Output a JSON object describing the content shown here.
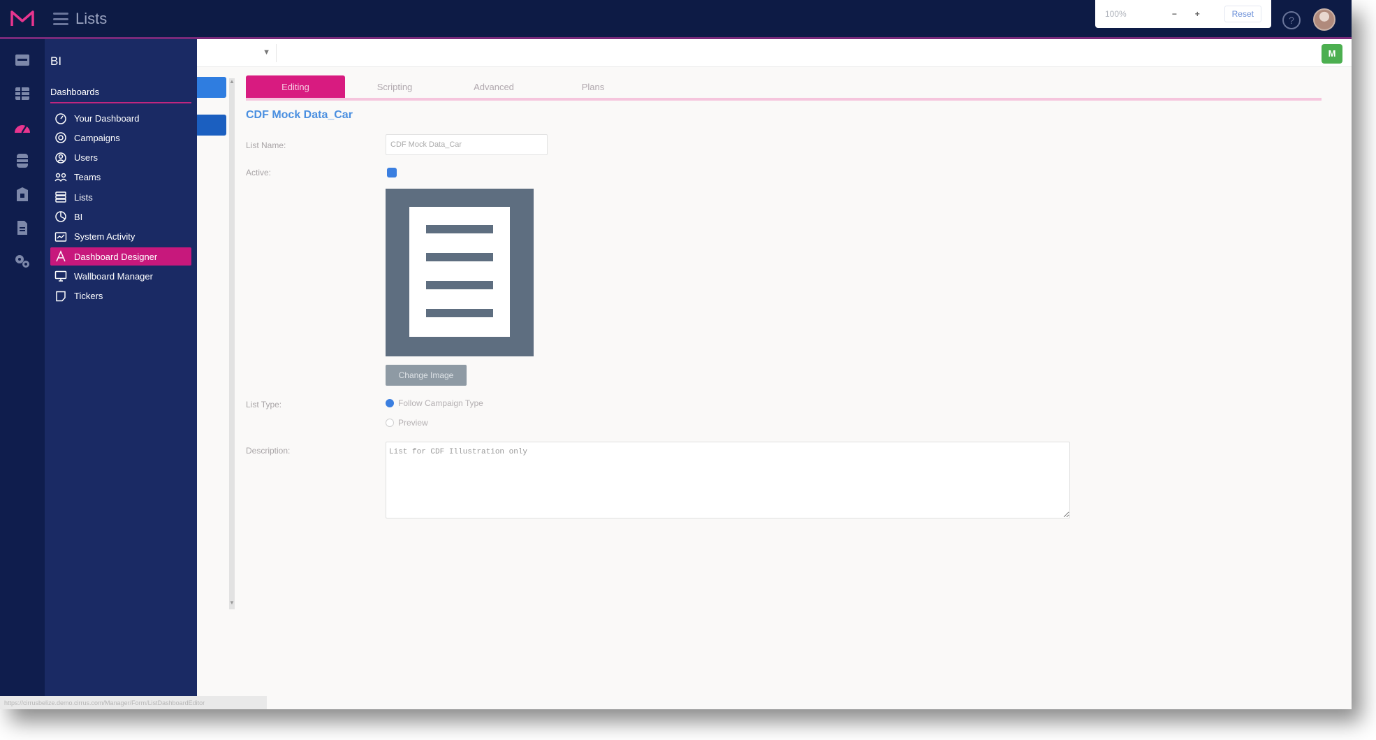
{
  "topbar": {
    "page_title": "Lists",
    "zoom": {
      "value": "100%",
      "minus": "−",
      "plus": "+",
      "reset": "Reset"
    },
    "help": "?"
  },
  "sidebar": {
    "title": "BI",
    "section": "Dashboards",
    "items": [
      {
        "label": "Your Dashboard",
        "icon": "dashboard-gauge-icon"
      },
      {
        "label": "Campaigns",
        "icon": "campaign-icon"
      },
      {
        "label": "Users",
        "icon": "user-circle-icon"
      },
      {
        "label": "Teams",
        "icon": "team-icon"
      },
      {
        "label": "Lists",
        "icon": "list-icon"
      },
      {
        "label": "BI",
        "icon": "chart-pie-icon"
      },
      {
        "label": "System Activity",
        "icon": "activity-icon"
      },
      {
        "label": "Dashboard Designer",
        "icon": "designer-icon",
        "active": true
      },
      {
        "label": "Wallboard Manager",
        "icon": "monitor-icon"
      },
      {
        "label": "Tickers",
        "icon": "ticker-icon"
      }
    ]
  },
  "toolbar": {
    "app_badge": "M"
  },
  "tabs": [
    {
      "label": "Editing",
      "active": true
    },
    {
      "label": "Scripting"
    },
    {
      "label": "Advanced"
    },
    {
      "label": "Plans"
    }
  ],
  "form": {
    "record_title": "CDF Mock Data_Car",
    "list_name_label": "List Name:",
    "list_name_value": "CDF Mock Data_Car",
    "active_label": "Active:",
    "active_checked": true,
    "change_image_label": "Change Image",
    "list_type_label": "List Type:",
    "list_type_options": [
      {
        "label": "Follow Campaign Type",
        "selected": true
      },
      {
        "label": "Preview",
        "selected": false
      }
    ],
    "description_label": "Description:",
    "description_value": "List for CDF Illustration only"
  },
  "status_url": "https://cirrusbelize.demo.cirrus.com/Manager/Form/ListDashboardEditor",
  "colors": {
    "topbar": "#0d1b45",
    "sidebar": "#1a2a64",
    "accent": "#d81b80",
    "link": "#4a8fe0",
    "primary": "#2f7de0"
  }
}
